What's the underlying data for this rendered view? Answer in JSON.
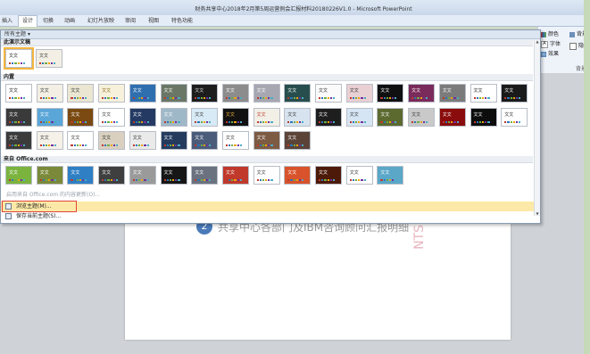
{
  "window": {
    "title": "财务共享中心2018年2月第5周运营例会汇报材料20180226V1.0 - Microsoft PowerPoint"
  },
  "tabs": [
    "插入",
    "设计",
    "切换",
    "动画",
    "幻灯片放映",
    "审阅",
    "视图",
    "特色功能"
  ],
  "active_tab": "设计",
  "ribbon": {
    "colors_label": "颜色",
    "fonts_label": "字体",
    "effects_label": "效果",
    "bg_style_label": "背景",
    "hide_bg_label": "隐藏",
    "bg_group_label": "背景"
  },
  "gallery": {
    "header": "所有主题",
    "section_current": "此演示文稿",
    "section_builtin": "内置",
    "section_office": "来自 Office.com",
    "enable_updates": "启用来自 Office.com 的内容更新(O)...",
    "browse_label": "浏览主题(M)...",
    "save_label": "保存当前主题(S)..."
  },
  "slide": {
    "number": "2",
    "heading": "共享中心各部门及IBM咨询顾问汇报明细",
    "watermark": "NTS"
  },
  "theme_thumb_text": "文文",
  "colors": {
    "accent": "#f3b63d",
    "highlight": "#fde9a7",
    "red_box": "#e0453a"
  }
}
